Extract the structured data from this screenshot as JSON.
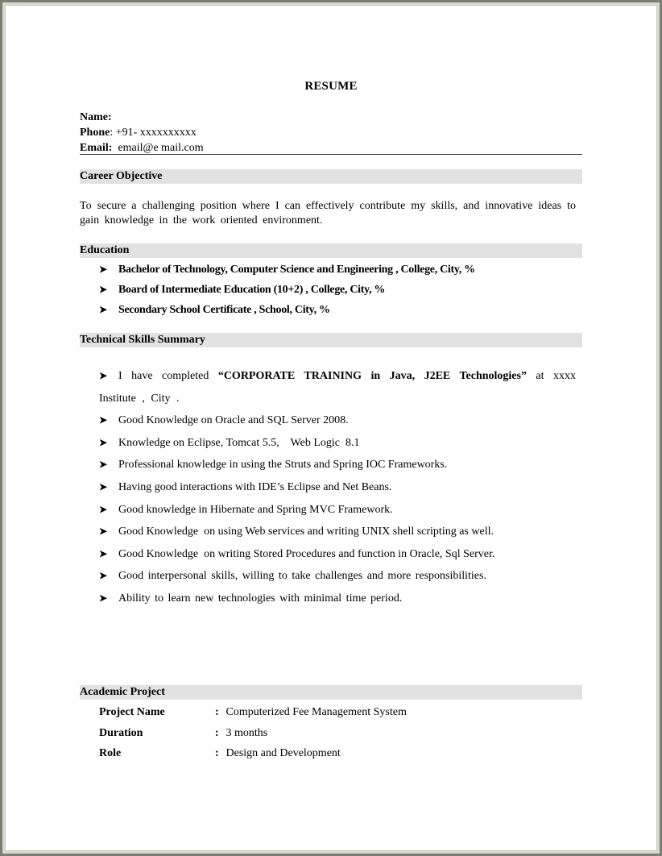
{
  "document": {
    "title": "RESUME",
    "contact": {
      "name_label": "Name:",
      "name_value": "",
      "phone_label": "Phone",
      "phone_value": ": +91- xxxxxxxxxx",
      "email_label": "Email:",
      "email_value": "email@e mail.com"
    },
    "sections": {
      "career_objective": {
        "heading": "Career Objective",
        "text": "To secure a challenging  position  where I can effectively  contribute  my skills,  and innovative ideas to gain knowledge in the work oriented environment."
      },
      "education": {
        "heading": "Education",
        "items": [
          "Bachelor of Technology, Computer Science and Engineering   , College, City, %",
          "Board of Intermediate Education (10+2) , College, City, %",
          "Secondary School Certificate , School, City, %"
        ]
      },
      "technical_skills": {
        "heading": "Technical Skills Summary",
        "first_item": {
          "prefix": "I have completed ",
          "bold": "“CORPORATE TRAINING in Java, J2EE Technologies”",
          "suffix": " at xxxx Institute , City ."
        },
        "items": [
          "Good Knowledge on Oracle and SQL Server 2008.",
          "Knowledge on Eclipse, Tomcat 5.5,    Web Logic  8.1",
          "Professional knowledge in using the Struts and Spring IOC Frameworks.",
          "Having good interactions with IDE’s Eclipse and Net Beans.",
          "Good knowledge in Hibernate and Spring MVC Framework.",
          "Good Knowledge  on using Web services and writing UNIX shell scripting as well.",
          "Good Knowledge  on writing Stored Procedures and function in Oracle, Sql Server.",
          "Good interpersonal skills, willing to take challenges and more responsibilities.",
          "Ability to learn new technologies with minimal time period."
        ]
      },
      "academic_project": {
        "heading": "Academic Project",
        "rows": [
          {
            "key": "Project Name",
            "colon": ":",
            "value": "Computerized Fee Management System"
          },
          {
            "key": "Duration",
            "colon": ":",
            "value": "3 months"
          },
          {
            "key": "Role",
            "colon": ":",
            "value": "Design and Development"
          }
        ]
      }
    },
    "bullet_glyph": "➤"
  }
}
